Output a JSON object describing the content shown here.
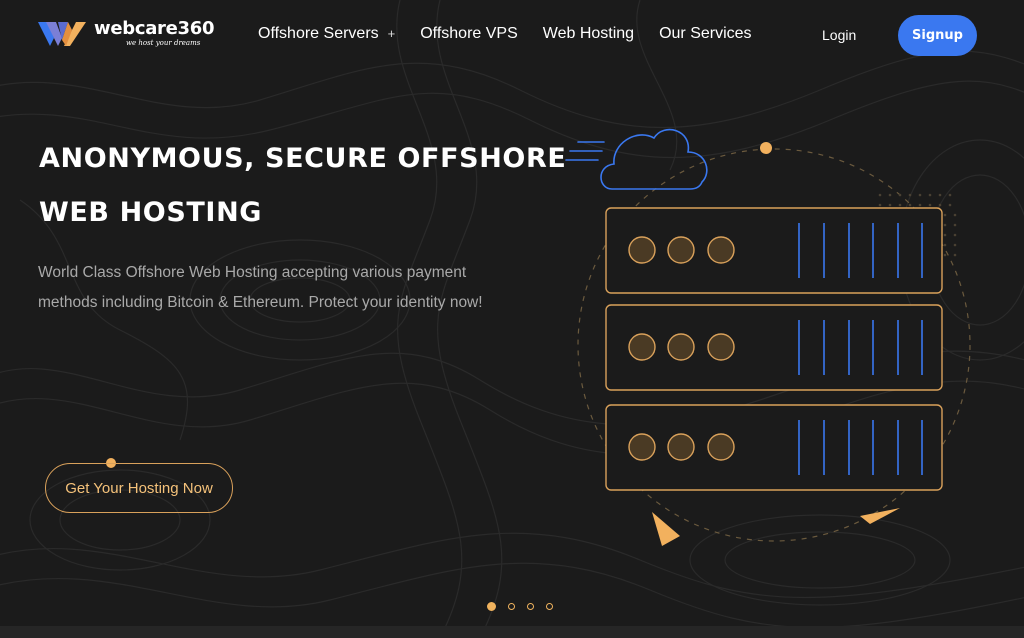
{
  "brand": {
    "name": "webcare360",
    "tagline": "we host your dreams",
    "colors": {
      "primary_blue": "#3a78f0",
      "accent_orange": "#f2b15e",
      "background": "#1b1b1b"
    }
  },
  "nav": {
    "items": [
      {
        "label": "Offshore Servers",
        "has_submenu": true,
        "submenu_icon": "plus-icon",
        "submenu_glyph": "+"
      },
      {
        "label": "Offshore VPS"
      },
      {
        "label": "Web Hosting"
      },
      {
        "label": "Our Services"
      }
    ],
    "login_label": "Login",
    "signup_label": "Signup"
  },
  "hero": {
    "title_line1": "ANONYMOUS, SECURE OFFSHORE",
    "title_line2": "WEB HOSTING",
    "description": "World Class Offshore Web Hosting accepting various payment methods including Bitcoin & Ethereum. Protect your identity now!",
    "cta_label": "Get Your Hosting Now"
  },
  "illustration": {
    "icons": [
      "cloud-icon",
      "server-rack-icon"
    ],
    "server_units": 3
  },
  "slider": {
    "count": 4,
    "active_index": 0
  }
}
